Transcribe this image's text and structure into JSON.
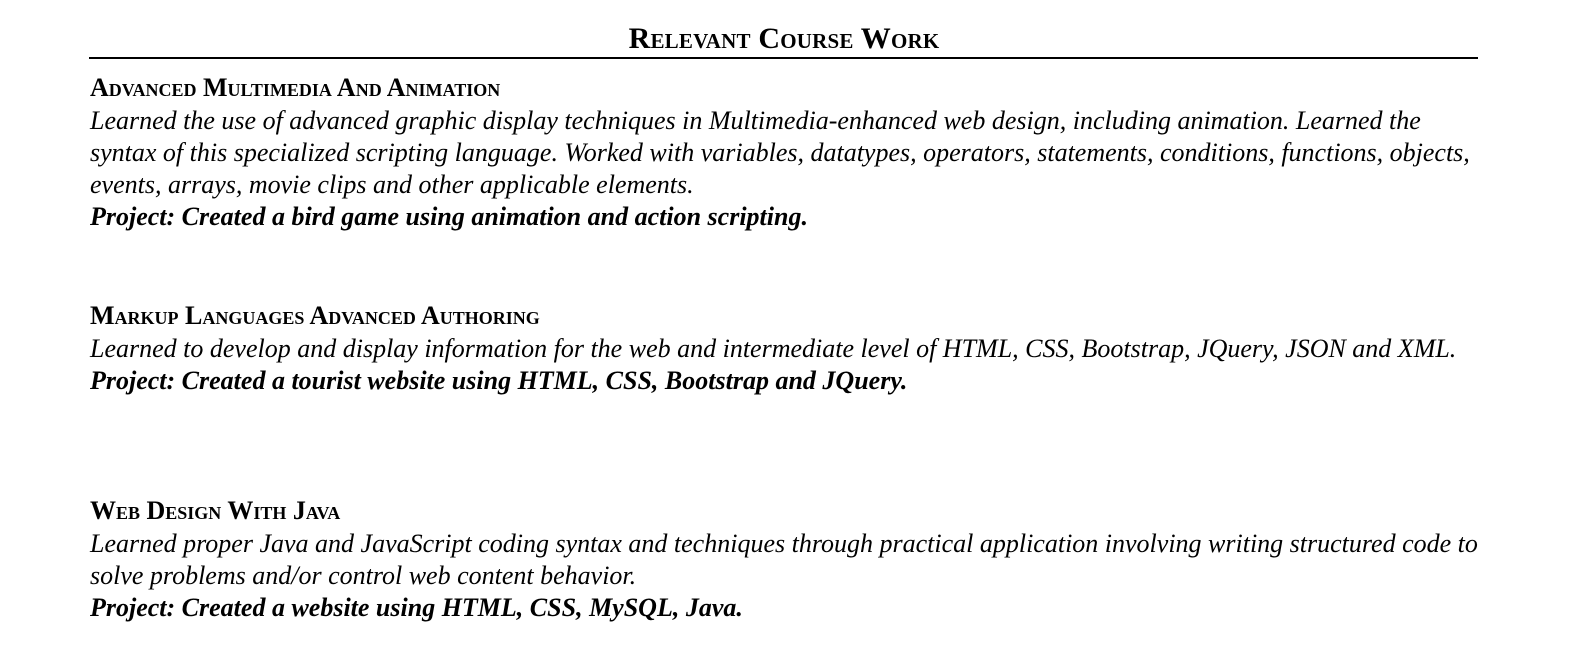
{
  "section": {
    "title": "Relevant Course Work"
  },
  "courses": [
    {
      "title": "Advanced Multimedia And Animation",
      "description": "Learned the use of advanced graphic display techniques in Multimedia-enhanced web design, including animation. Learned the syntax of this specialized scripting language. Worked with variables, datatypes, operators, statements, conditions, functions, objects, events, arrays, movie clips and other applicable elements.",
      "project": "Project: Created a bird game using animation and action scripting."
    },
    {
      "title": "Markup Languages Advanced Authoring",
      "description": "Learned to develop and display information for the web and intermediate level of HTML, CSS, Bootstrap, JQuery, JSON and XML.",
      "project": "Project: Created a tourist website using HTML, CSS, Bootstrap and JQuery."
    },
    {
      "title": "Web Design With Java",
      "description": "Learned proper Java and JavaScript coding syntax and techniques through practical application involving writing structured code to solve problems and/or control web content behavior.",
      "project": "Project: Created a website using HTML, CSS, MySQL, Java."
    }
  ]
}
